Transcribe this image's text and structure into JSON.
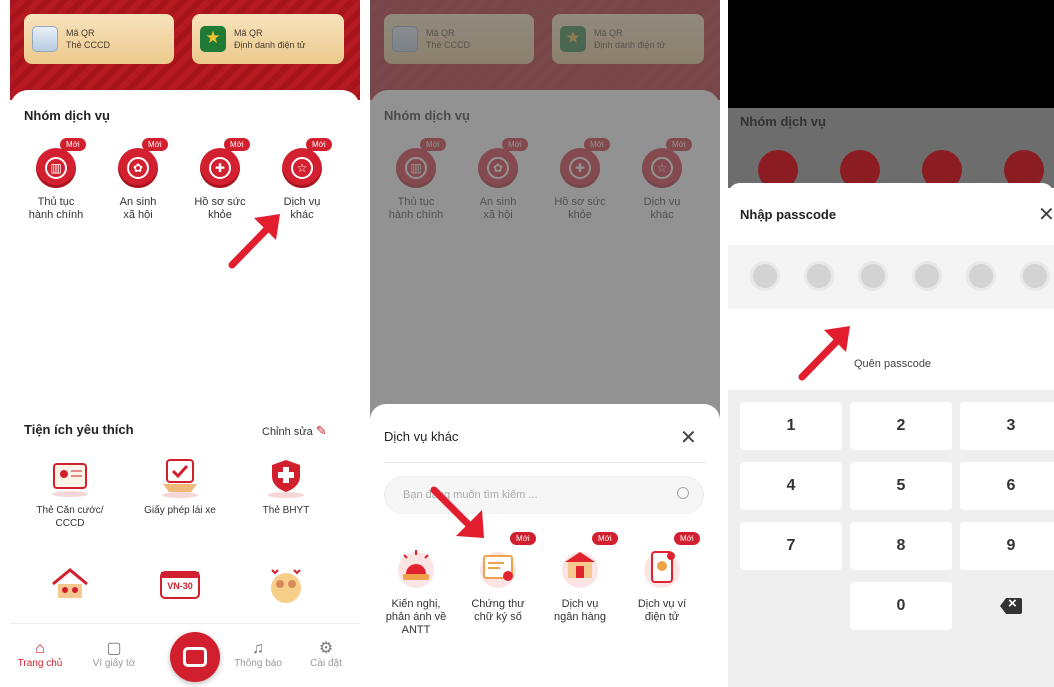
{
  "colors": {
    "brand_red": "#d11f2e",
    "header_red": "#b51a21",
    "qr_card": "#f0d6a2"
  },
  "home": {
    "qr_cards": [
      {
        "title": "Mã QR",
        "subtitle": "Thẻ CCCD",
        "icon": "id-card-icon"
      },
      {
        "title": "Mã QR",
        "subtitle": "Định danh điện tử",
        "icon": "vneid-emblem-icon"
      }
    ],
    "services_title": "Nhóm dịch vụ",
    "new_badge": "Mới",
    "services": [
      {
        "line1": "Thủ tục",
        "line2": "hành chính",
        "icon": "building-icon"
      },
      {
        "line1": "An sinh",
        "line2": "xã hội",
        "icon": "flower-icon"
      },
      {
        "line1": "Hồ sơ sức",
        "line2": "khỏe",
        "icon": "health-shield-icon"
      },
      {
        "line1": "Dịch vụ",
        "line2": "khác",
        "icon": "star-podium-icon"
      }
    ],
    "favorites_title": "Tiện ích yêu thích",
    "edit_label": "Chỉnh sửa",
    "favorites": [
      {
        "line1": "Thẻ Căn cước/",
        "line2": "CCCD",
        "icon": "citizen-card-icon"
      },
      {
        "line1": "Giấy phép lái xe",
        "line2": "",
        "icon": "driver-license-icon"
      },
      {
        "line1": "Thẻ BHYT",
        "line2": "",
        "icon": "health-insurance-icon"
      },
      {
        "line1": "",
        "line2": "",
        "icon": "household-icon"
      },
      {
        "line1": "",
        "line2": "",
        "icon": "vehicle-plate-icon"
      },
      {
        "line1": "",
        "line2": "",
        "icon": "family-icon"
      }
    ],
    "plate_text": "VN-30",
    "nav": [
      {
        "label": "Trang chủ",
        "icon": "home-icon"
      },
      {
        "label": "Ví giấy tờ",
        "icon": "wallet-icon"
      },
      {
        "label": "Thông báo",
        "icon": "bell-icon"
      },
      {
        "label": "Cài đặt",
        "icon": "settings-icon"
      }
    ]
  },
  "other_services_sheet": {
    "title": "Dịch vụ khác",
    "search_placeholder": "Bạn đang muốn tìm kiếm ...",
    "items": [
      {
        "line1": "Kiến nghị,",
        "line2": "phản ánh về",
        "line3": "ANTT",
        "new": false,
        "icon": "siren-icon"
      },
      {
        "line1": "Chứng thư",
        "line2": "chữ ký số",
        "line3": "",
        "new": true,
        "icon": "certificate-icon"
      },
      {
        "line1": "Dịch vụ",
        "line2": "ngân hàng",
        "line3": "",
        "new": true,
        "icon": "bank-icon"
      },
      {
        "line1": "Dịch vụ ví",
        "line2": "điện tử",
        "line3": "",
        "new": true,
        "icon": "e-wallet-icon"
      }
    ]
  },
  "passcode_sheet": {
    "title": "Nhập passcode",
    "forgot_label": "Quên passcode",
    "keys": [
      "1",
      "2",
      "3",
      "4",
      "5",
      "6",
      "7",
      "8",
      "9",
      "0"
    ]
  }
}
